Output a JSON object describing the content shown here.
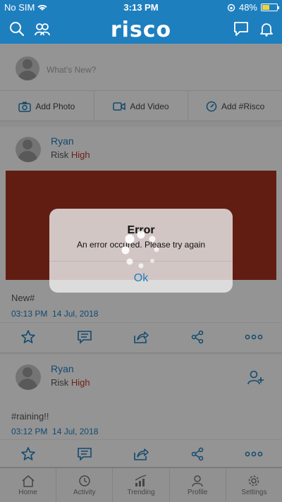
{
  "status": {
    "carrier": "No SIM",
    "time": "3:13 PM",
    "battery": "48%",
    "battery_level": 0.48
  },
  "header": {
    "logo": "risco"
  },
  "composer": {
    "placeholder": "What's New?",
    "actions": [
      {
        "label": "Add Photo",
        "icon": "camera-icon"
      },
      {
        "label": "Add Video",
        "icon": "video-icon"
      },
      {
        "label": "Add #Risco",
        "icon": "compass-icon"
      }
    ]
  },
  "posts": [
    {
      "name": "Ryan",
      "risk_label": "Risk",
      "risk_level": "High",
      "caption": "New#",
      "time": "03:13 PM",
      "date": "14 Jul, 2018"
    },
    {
      "name": "Ryan",
      "risk_label": "Risk",
      "risk_level": "High",
      "caption": "#raining!!",
      "time": "03:12 PM",
      "date": "14 Jul, 2018"
    }
  ],
  "tabs": [
    {
      "label": "Home",
      "icon": "home-icon"
    },
    {
      "label": "Activity",
      "icon": "clock-icon"
    },
    {
      "label": "Trending",
      "icon": "chart-icon"
    },
    {
      "label": "Profile",
      "icon": "person-icon"
    },
    {
      "label": "Settings",
      "icon": "gear-icon"
    }
  ],
  "alert": {
    "title": "Error",
    "message": "An error occured. Please try again",
    "button": "Ok"
  },
  "colors": {
    "brand": "#1e7fbf",
    "risk_high": "#c0392b",
    "banner": "#a93322"
  }
}
